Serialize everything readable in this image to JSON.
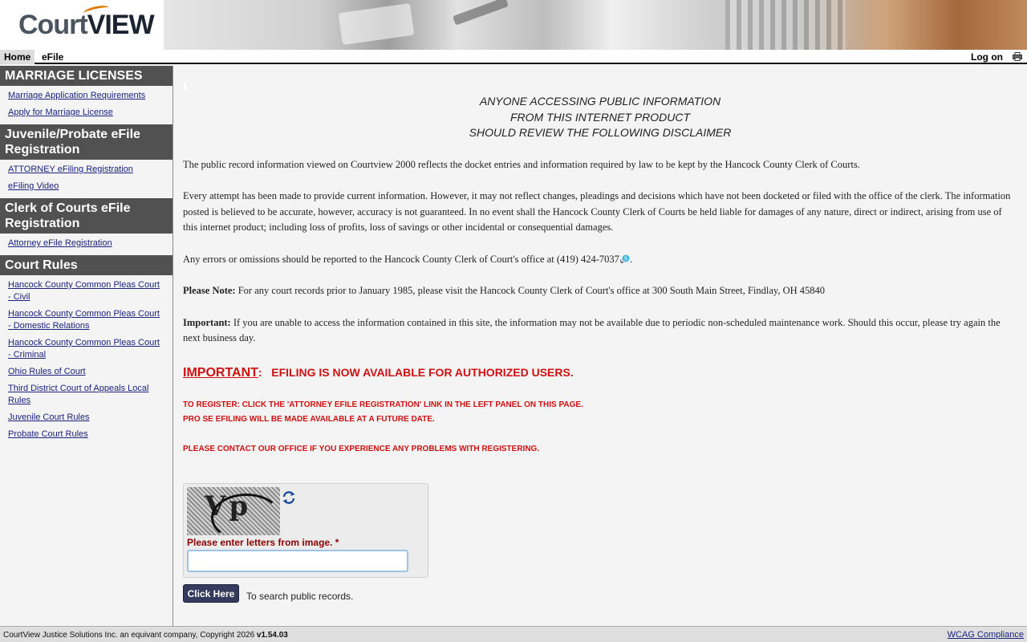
{
  "header": {
    "logo_part1": "Court",
    "logo_part2": "VIEW"
  },
  "nav": {
    "home": "Home",
    "efile": "eFile",
    "login": "Log on"
  },
  "sidebar": {
    "sections": [
      {
        "title": "MARRIAGE LICENSES",
        "links": [
          "Marriage Application Requirements",
          "Apply for Marriage License"
        ]
      },
      {
        "title": "Juvenile/Probate eFile Registration",
        "links": [
          "ATTORNEY eFiling Registration",
          "eFiling Video"
        ]
      },
      {
        "title": "Clerk of Courts eFile Registration",
        "links": [
          "Attorney eFile Registration"
        ]
      },
      {
        "title": "Court Rules",
        "links": [
          "Hancock County Common Pleas Court - Civil",
          "Hancock County Common Pleas Court - Domestic Relations",
          "Hancock County Common Pleas Court - Criminal",
          "Ohio Rules of Court",
          "Third District Court of Appeals Local Rules",
          "Juvenile Court Rules",
          "Probate Court Rules"
        ]
      }
    ]
  },
  "main": {
    "disclaimer_lines": [
      "ANYONE ACCESSING PUBLIC INFORMATION",
      "FROM THIS INTERNET PRODUCT",
      "SHOULD REVIEW THE FOLLOWING DISCLAIMER"
    ],
    "para1": "The public record information viewed on Courtview 2000 reflects the docket entries and information required by law to be kept by the Hancock County Clerk of Courts.",
    "para2": "Every attempt has been made to provide current information. However, it may not reflect changes, pleadings and decisions which have not been docketed or filed with the office of the clerk. The information posted is believed to be accurate, however, accuracy is not guaranteed. In no event shall the Hancock County Clerk of Courts be held liable for damages of any nature, direct or indirect, arising from use of this internet product; including loss of profits, loss of savings or other incidental or consequential damages.",
    "para3_prefix": "Any errors or omissions should be reported to the Hancock County Clerk of Court's office at (419) 424-7037",
    "para3_suffix": ".",
    "note_label": "Please Note:",
    "note_text": " For any court records prior to January 1985, please visit the Hancock County Clerk of Court's office at 300 South Main Street, Findlay, OH 45840",
    "important_label": "Important:",
    "important_text": " If you are unable to access the information contained in this site, the information may not be available due to periodic non-scheduled maintenance work. Should this occur, please try again the next business day.",
    "alert_word": "IMPORTANT",
    "alert_colon": ":",
    "alert_text": "EFILING IS NOW AVAILABLE FOR AUTHORIZED USERS.",
    "register_line1": "TO REGISTER: CLICK THE 'ATTORNEY EFILE REGISTRATION' LINK IN THE LEFT PANEL ON THIS PAGE.",
    "register_line2": "PRO SE EFILING WILL BE MADE AVAILABLE AT A FUTURE DATE.",
    "contact_line": "PLEASE CONTACT OUR OFFICE IF YOU EXPERIENCE ANY PROBLEMS WITH REGISTERING.",
    "captcha_letters": "Vp",
    "captcha_label": "Please enter letters from image.",
    "captcha_required": "*",
    "captcha_value": "",
    "search_button": "Click Here",
    "search_text": "To search public records."
  },
  "footer": {
    "copyright": "CourtView Justice Solutions Inc. an equivant company, Copyright 2026 ",
    "version": "v1.54.03",
    "wcag": "WCAG Compliance"
  },
  "colors": {
    "sidebar_header": "#515151",
    "alert_red": "#d01010",
    "button": "#343b5c",
    "link": "#1a237e"
  }
}
